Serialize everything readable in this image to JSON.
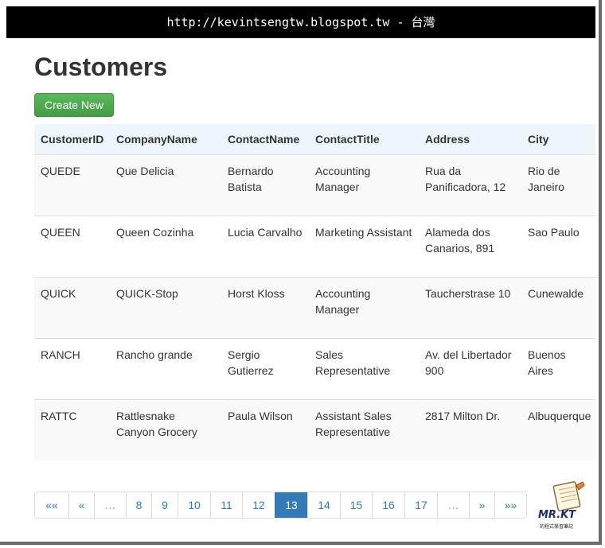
{
  "banner": {
    "text": "http://kevintsengtw.blogspot.tw - 台灣"
  },
  "page": {
    "title": "Customers",
    "create_label": "Create New"
  },
  "table": {
    "columns": [
      "CustomerID",
      "CompanyName",
      "ContactName",
      "ContactTitle",
      "Address",
      "City"
    ],
    "rows": [
      [
        "QUEDE",
        "Que Delicia",
        "Bernardo Batista",
        "Accounting Manager",
        "Rua da Panificadora, 12",
        "Rio de Janeiro"
      ],
      [
        "QUEEN",
        "Queen Cozinha",
        "Lucia Carvalho",
        "Marketing Assistant",
        "Alameda dos Canarios, 891",
        "Sao Paulo"
      ],
      [
        "QUICK",
        "QUICK-Stop",
        "Horst Kloss",
        "Accounting Manager",
        "Taucherstrase 10",
        "Cunewalde"
      ],
      [
        "RANCH",
        "Rancho grande",
        "Sergio Gutierrez",
        "Sales Representative",
        "Av. del Libertador 900",
        "Buenos Aires"
      ],
      [
        "RATTC",
        "Rattlesnake Canyon Grocery",
        "Paula Wilson",
        "Assistant Sales Representative",
        "2817 Milton Dr.",
        "Albuquerque"
      ]
    ]
  },
  "pagination": {
    "items": [
      "««",
      "«",
      "…",
      "8",
      "9",
      "10",
      "11",
      "12",
      "13",
      "14",
      "15",
      "16",
      "17",
      "…",
      "»",
      "»»"
    ],
    "active": "13"
  },
  "logo": {
    "name": "MR.KT",
    "caption": "的程式學習筆記",
    "accent": "#1a2a6c"
  },
  "colors": {
    "header_bg": "#eef5fd",
    "btn_green": "#5cb85c",
    "active_page": "#337ab7",
    "link": "#337ab7"
  }
}
